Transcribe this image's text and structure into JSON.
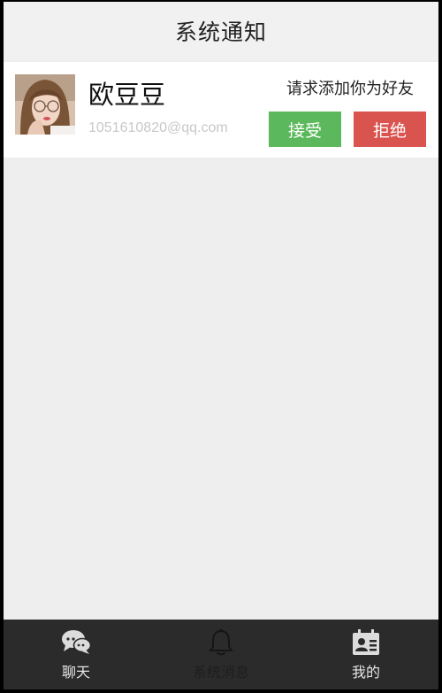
{
  "header": {
    "title": "系统通知"
  },
  "notification": {
    "name": "欧豆豆",
    "email": "1051610820@qq.com",
    "message": "请求添加你为好友",
    "accept_label": "接受",
    "reject_label": "拒绝",
    "avatar_icon": "user-avatar-photo"
  },
  "tabbar": {
    "tabs": [
      {
        "label": "聊天",
        "icon": "chat-bubbles-icon",
        "state": "active"
      },
      {
        "label": "系统消息",
        "icon": "bell-icon",
        "state": "inactive"
      },
      {
        "label": "我的",
        "icon": "contact-card-icon",
        "state": "active"
      }
    ]
  },
  "colors": {
    "accept": "#5cb85c",
    "reject": "#d9534f",
    "tabbar_bg": "#2b2b2b",
    "page_bg": "#eeeeee"
  }
}
